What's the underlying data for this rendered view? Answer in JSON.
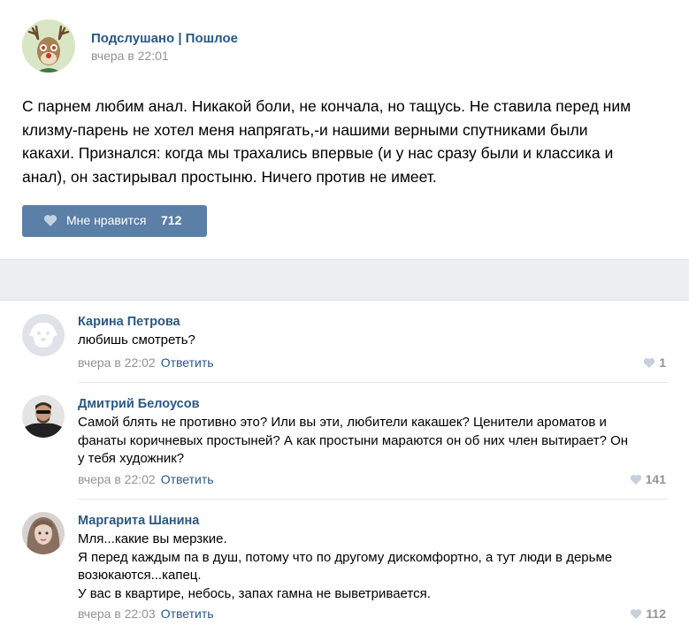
{
  "post": {
    "group_name": "Подслушано | Пошлое",
    "time": "вчера в 22:01",
    "text_lines": [
      "С парнем любим анал. Никакой боли, не кончала, но тащусь. Не ставила перед ним",
      "клизму-парень не хотел меня напрягать,-и нашими верными спутниками были",
      "какахи. Признался: когда мы трахались впервые (и у нас сразу были и классика и",
      "анал), он застирывал простыню. Ничего против не имеет."
    ],
    "like_label": "Мне нравится",
    "like_count": "712"
  },
  "comments": [
    {
      "author": "Карина Петрова",
      "lines": [
        "любишь смотреть?"
      ],
      "time": "вчера в 22:02",
      "reply": "Ответить",
      "likes": "1"
    },
    {
      "author": "Дмитрий Белоусов",
      "lines": [
        "Самой блять не противно это? Или вы эти, любители какашек? Ценители ароматов и",
        "фанаты коричневых простыней? А как простыни мараются он об них член вытирает? Он",
        "у тебя художник?"
      ],
      "time": "вчера в 22:02",
      "reply": "Ответить",
      "likes": "141"
    },
    {
      "author": "Маргарита Шанина",
      "lines": [
        "Мля...какие вы мерзкие.",
        "Я перед каждым па в душ, потому что по другому дискомфортно, а тут люди в дерьме",
        "возюкаются...капец.",
        "У вас в квартире, небось, запах гамна не выветривается."
      ],
      "time": "вчера в 22:03",
      "reply": "Ответить",
      "likes": "112"
    }
  ],
  "colors": {
    "link": "#2a5885",
    "button": "#5b7fa6",
    "meta": "#939393",
    "separator": "#edeef0"
  },
  "icons": {
    "group_avatar": "deer-avatar-icon",
    "like": "heart-icon",
    "default_avatar": "vk-dog-avatar-icon"
  }
}
